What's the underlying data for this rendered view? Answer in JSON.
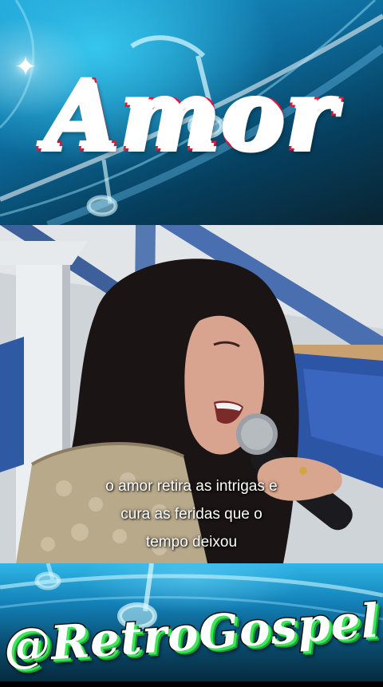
{
  "banner": {
    "title": "Amor"
  },
  "video": {
    "caption_line1": "o amor retira as intrigas e",
    "caption_line2": "cura as feridas que o",
    "caption_line3": "tempo deixou"
  },
  "footer": {
    "handle": "@RetroGospel"
  },
  "colors": {
    "title_outline": "#e8173a",
    "handle_shadow": "#3ee65a",
    "banner_blue": "#1d9fd4"
  },
  "icons": [
    "music-note-icon",
    "sparkle-icon"
  ]
}
